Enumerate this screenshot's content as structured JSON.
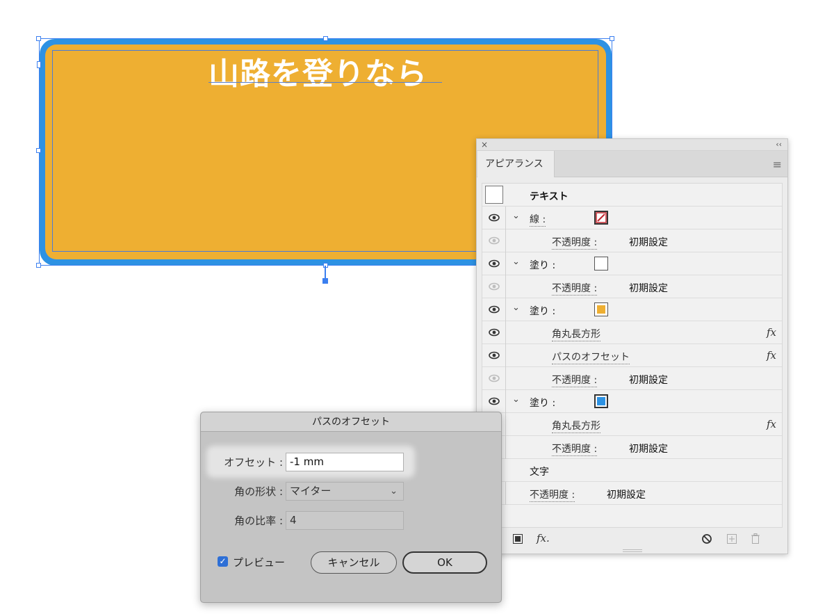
{
  "canvas": {
    "headline": "山路を登りなら",
    "colors": {
      "outer": "#2d92e3",
      "inner": "#eeaf32",
      "selection": "#3b7ff0"
    }
  },
  "appearance_panel": {
    "tab": "アピアランス",
    "close_glyph": "×",
    "collapse_glyph": "‹‹",
    "menu_glyph": "≡",
    "target": "テキスト",
    "rows": [
      {
        "label": "線 :",
        "swatch": "stroke-red"
      },
      {
        "label": "不透明度 :",
        "value": "初期設定"
      },
      {
        "label": "塗り :",
        "swatch": "white"
      },
      {
        "label": "不透明度 :",
        "value": "初期設定"
      },
      {
        "label": "塗り :",
        "swatch": "orange"
      },
      {
        "label": "角丸長方形",
        "fx": "fx"
      },
      {
        "label": "パスのオフセット",
        "fx": "fx"
      },
      {
        "label": "不透明度 :",
        "value": "初期設定"
      },
      {
        "label": "塗り :",
        "swatch": "blue"
      },
      {
        "label": "角丸長方形",
        "fx": "fx"
      },
      {
        "label": "不透明度 :",
        "value": "初期設定"
      },
      {
        "label": "文字"
      },
      {
        "label": "不透明度 :",
        "value": "初期設定"
      }
    ],
    "footer": {
      "fx_label": "fx."
    }
  },
  "offset_dialog": {
    "title": "パスのオフセット",
    "offset_label": "オフセット :",
    "offset_value": "-1 mm",
    "join_label": "角の形状 :",
    "join_value": "マイター",
    "limit_label": "角の比率 :",
    "limit_value": "4",
    "preview_label": "プレビュー",
    "preview_checked": true,
    "cancel_label": "キャンセル",
    "ok_label": "OK"
  }
}
